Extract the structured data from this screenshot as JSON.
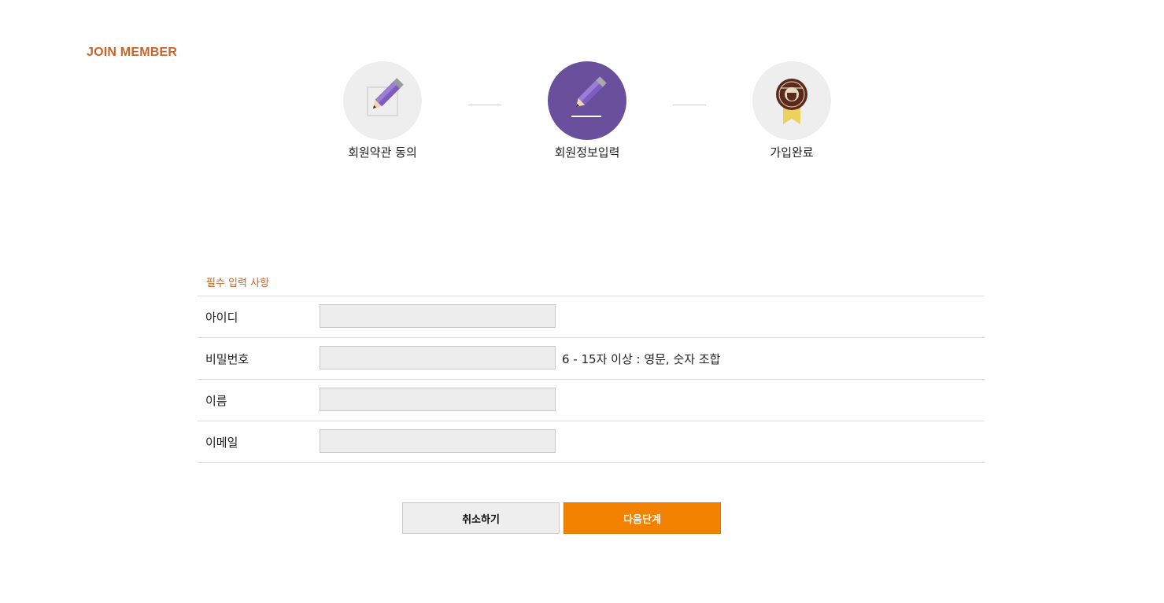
{
  "page": {
    "title": "JOIN MEMBER"
  },
  "steps": [
    {
      "label": "회원약관 동의",
      "icon": "pencil-note-icon",
      "active": false
    },
    {
      "label": "회원정보입력",
      "icon": "pencil-write-icon",
      "active": true
    },
    {
      "label": "가입완료",
      "icon": "coffee-badge-icon",
      "active": false
    }
  ],
  "form": {
    "section_title": "필수 입력 사항",
    "fields": [
      {
        "label": "아이디",
        "value": "",
        "placeholder": ""
      },
      {
        "label": "비밀번호",
        "value": "",
        "placeholder": "",
        "hint": "6 - 15자 이상 : 영문, 숫자 조합"
      },
      {
        "label": "이름",
        "value": "",
        "placeholder": ""
      },
      {
        "label": "이메일",
        "value": "",
        "placeholder": ""
      }
    ]
  },
  "buttons": {
    "cancel": "취소하기",
    "next": "다음단계"
  },
  "colors": {
    "accent": "#c8642a",
    "active_step": "#6a4f9c",
    "primary_button": "#f28100"
  }
}
